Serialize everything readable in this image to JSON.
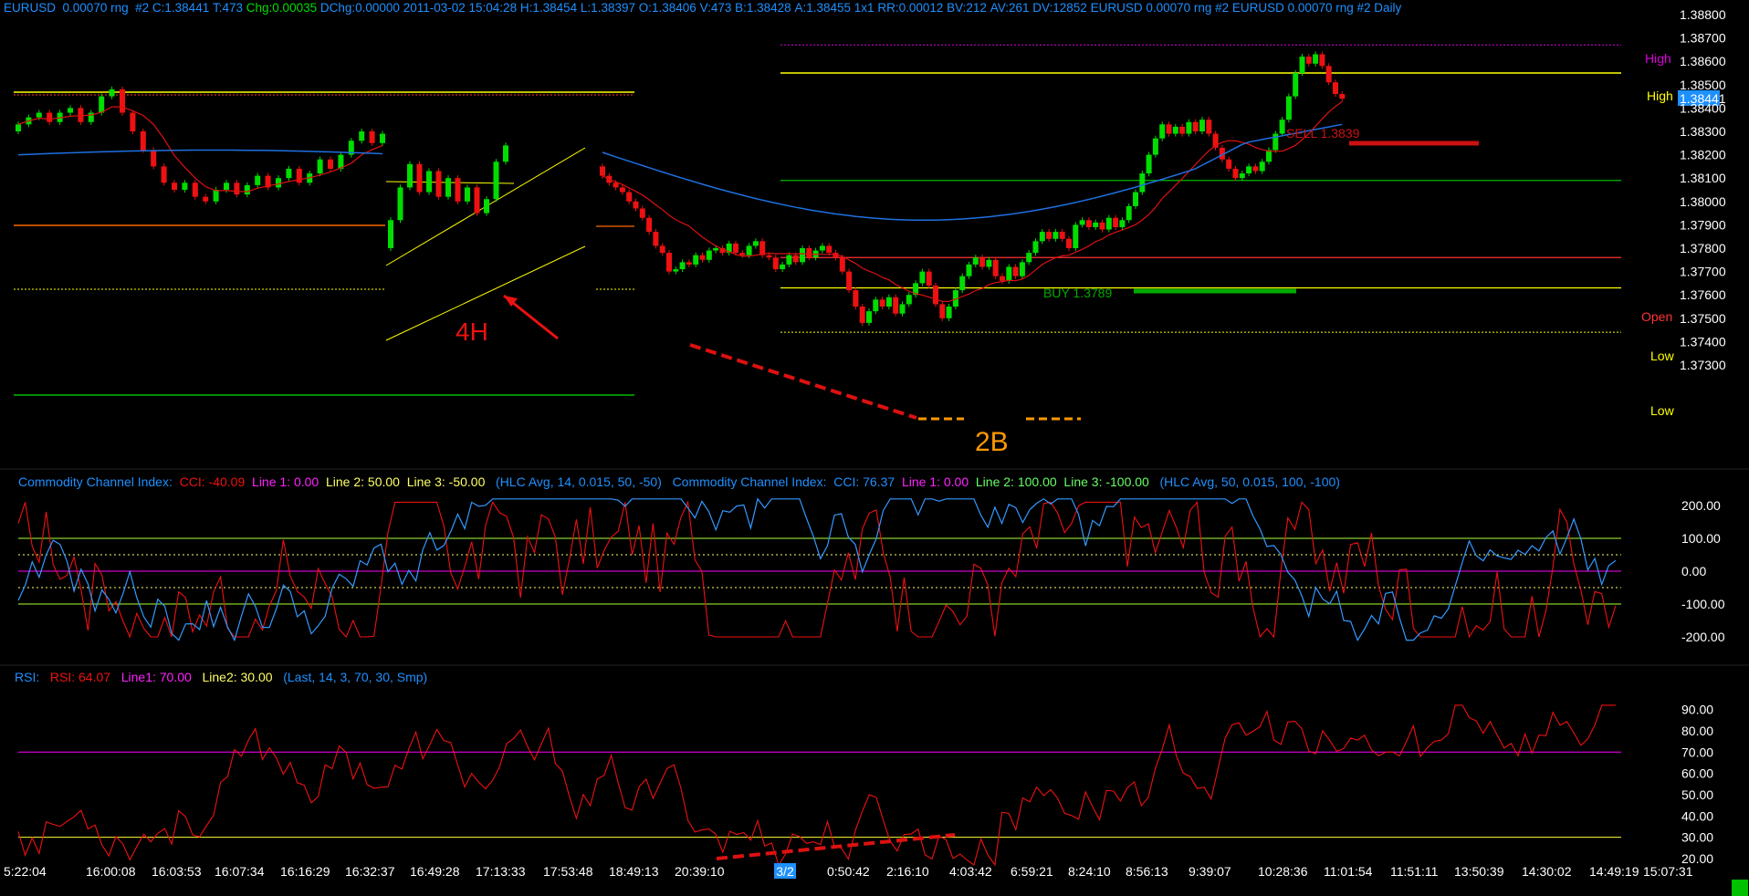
{
  "header": {
    "symbol": "EURUSD",
    "range": "0.00070 rng",
    "chart_no": "#2",
    "close": "C:1.38441",
    "ticks": "T:473",
    "change": "Chg:0.00035",
    "dchange": "DChg:0.00000",
    "datetime": "2011-03-02 15:04:28",
    "high": "H:1.38454",
    "low": "L:1.38397",
    "open": "O:1.38406",
    "volume": "V:473",
    "bid": "B:1.38428",
    "ask": "A:1.38455",
    "ratio": "1x1",
    "rr": "RR:0.00012",
    "bv": "BV:212",
    "av": "AV:261",
    "dv": "DV:12852",
    "tail": "EURUSD  0.00070 rng  #2 EURUSD  0.00070 rng  #2 Daily"
  },
  "price_axis": {
    "ticks": [
      "1.38800",
      "1.38700",
      "1.38600",
      "1.38500",
      "1.38441",
      "1.38400",
      "1.38300",
      "1.38200",
      "1.38100",
      "1.38000",
      "1.37900",
      "1.37800",
      "1.37700",
      "1.37600",
      "1.37500",
      "1.37400",
      "1.37300"
    ],
    "current": "1.38441"
  },
  "level_labels": {
    "high1": "High",
    "high2": "High",
    "open": "Open",
    "low1": "Low",
    "low2": "Low"
  },
  "annotations": {
    "sell": "SELL 1.3839",
    "buy": "BUY 1.3789",
    "tf": "4H",
    "pattern": "2B"
  },
  "cci": {
    "label1": "Commodity Channel Index:",
    "value1": "CCI: -40.09",
    "l1a": "Line 1: 0.00",
    "l2a": "Line 2: 50.00",
    "l3a": "Line 3: -50.00",
    "params1": "(HLC Avg, 14, 0.015, 50, -50)",
    "label2": "Commodity Channel Index:",
    "value2": "CCI: 76.37",
    "l1b": "Line 1: 0.00",
    "l2b": "Line 2: 100.00",
    "l3b": "Line 3: -100.00",
    "params2": "(HLC Avg, 50, 0.015, 100, -100)",
    "ticks": [
      "200.00",
      "100.00",
      "0.00",
      "-100.00",
      "-200.00"
    ]
  },
  "rsi": {
    "label": "RSI:",
    "value": "RSI: 64.07",
    "line1": "Line1: 70.00",
    "line2": "Line2: 30.00",
    "params": "(Last, 14, 3, 70, 30, Smp)",
    "ticks": [
      "90.00",
      "80.00",
      "70.00",
      "60.00",
      "50.00",
      "40.00",
      "30.00",
      "20.00"
    ]
  },
  "time_axis": {
    "labels": [
      "5:22:04",
      "16:00:08",
      "16:03:53",
      "16:07:34",
      "16:16:29",
      "16:32:37",
      "16:49:28",
      "17:13:33",
      "17:53:48",
      "18:49:13",
      "20:39:10",
      "3/2",
      "0:50:42",
      "2:16:10",
      "4:03:42",
      "6:59:21",
      "8:24:10",
      "8:56:13",
      "9:39:07",
      "10:28:36",
      "11:01:54",
      "11:51:11",
      "13:50:39",
      "14:30:02",
      "14:49:19",
      "15:07:31"
    ],
    "highlight": "3/2"
  },
  "colors": {
    "background": "#000000",
    "up_candle": "#00dd00",
    "down_candle": "#ee1111",
    "high_line": "#ffff00",
    "high_dotted": "#dd00dd",
    "support_green": "#00bb00",
    "open_line": "#ff3333",
    "ma_red": "#dd1111",
    "ma_blue": "#1e70e0",
    "axis_text": "#ffffff",
    "axis_highlight": "#1e90ff",
    "pattern": "#ff9900"
  },
  "chart_data": [
    {
      "type": "candlestick",
      "title": "EURUSD 0.00070 rng #2",
      "ylim": [
        1.3725,
        1.3885
      ],
      "y_ticks": [
        1.373,
        1.374,
        1.375,
        1.376,
        1.377,
        1.378,
        1.379,
        1.38,
        1.381,
        1.382,
        1.383,
        1.384,
        1.385,
        1.386,
        1.387,
        1.388
      ],
      "levels": {
        "high": 1.3855,
        "high_dotted": 1.3867,
        "open": 1.3776,
        "low": 1.3763,
        "low_dotted": 1.3744,
        "support": 1.3809
      },
      "segments": [
        {
          "name": "left",
          "closes": [
            1.3833,
            1.3836,
            1.3838,
            1.3834,
            1.3838,
            1.384,
            1.3834,
            1.3838,
            1.3845,
            1.3848,
            1.3838,
            1.383,
            1.3822,
            1.3815,
            1.3808,
            1.3805,
            1.3808,
            1.3802,
            1.38,
            1.3805,
            1.3808,
            1.3803,
            1.3807,
            1.3811,
            1.3806,
            1.381,
            1.3814,
            1.3808,
            1.3812,
            1.3818,
            1.3814,
            1.382,
            1.3826,
            1.383,
            1.3825,
            1.3829
          ]
        },
        {
          "name": "4H",
          "closes": [
            1.3792,
            1.3806,
            1.3816,
            1.3804,
            1.3813,
            1.3802,
            1.381,
            1.38,
            1.3806,
            1.3795,
            1.3801,
            1.3817,
            1.3824
          ]
        },
        {
          "name": "right",
          "closes": [
            1.3811,
            1.3808,
            1.3806,
            1.3804,
            1.38,
            1.3797,
            1.3793,
            1.3787,
            1.3781,
            1.3778,
            1.377,
            1.3771,
            1.3774,
            1.3773,
            1.3777,
            1.3775,
            1.3779,
            1.378,
            1.3778,
            1.3782,
            1.3778,
            1.3777,
            1.3781,
            1.3783,
            1.3777,
            1.3776,
            1.3771,
            1.3773,
            1.3777,
            1.3774,
            1.378,
            1.3776,
            1.3779,
            1.3781,
            1.3778,
            1.3776,
            1.377,
            1.3762,
            1.3755,
            1.3748,
            1.3753,
            1.3758,
            1.3755,
            1.3759,
            1.3752,
            1.3756,
            1.376,
            1.3765,
            1.377,
            1.3764,
            1.3756,
            1.375,
            1.3755,
            1.3762,
            1.3768,
            1.3773,
            1.3776,
            1.3772,
            1.3775,
            1.3768,
            1.3766,
            1.3772,
            1.3768,
            1.3774,
            1.3778,
            1.3783,
            1.3787,
            1.3784,
            1.3787,
            1.3784,
            1.378,
            1.379,
            1.3792,
            1.3789,
            1.3791,
            1.3788,
            1.3793,
            1.3789,
            1.3792,
            1.3798,
            1.3804,
            1.3812,
            1.382,
            1.3827,
            1.3833,
            1.3829,
            1.3832,
            1.3829,
            1.3834,
            1.383,
            1.3835,
            1.3829,
            1.3823,
            1.3818,
            1.3814,
            1.381,
            1.3812,
            1.3815,
            1.3813,
            1.3817,
            1.3822,
            1.3829,
            1.3835,
            1.3845,
            1.3855,
            1.3862,
            1.3859,
            1.3863,
            1.3858,
            1.3851,
            1.3846,
            1.3844
          ]
        }
      ],
      "series": [
        {
          "name": "MA red",
          "kind": "line"
        },
        {
          "name": "MA blue",
          "kind": "line"
        }
      ]
    },
    {
      "type": "line",
      "title": "Commodity Channel Index",
      "ylim": [
        -250,
        250
      ],
      "series": [
        {
          "name": "CCI 14",
          "last": -40.09
        },
        {
          "name": "CCI 50",
          "last": 76.37
        }
      ],
      "lines": [
        100,
        50,
        0,
        -50,
        -100
      ]
    },
    {
      "type": "line",
      "title": "RSI",
      "ylim": [
        15,
        95
      ],
      "series": [
        {
          "name": "RSI 14",
          "last": 64.07
        }
      ],
      "lines": [
        70,
        30
      ]
    }
  ]
}
